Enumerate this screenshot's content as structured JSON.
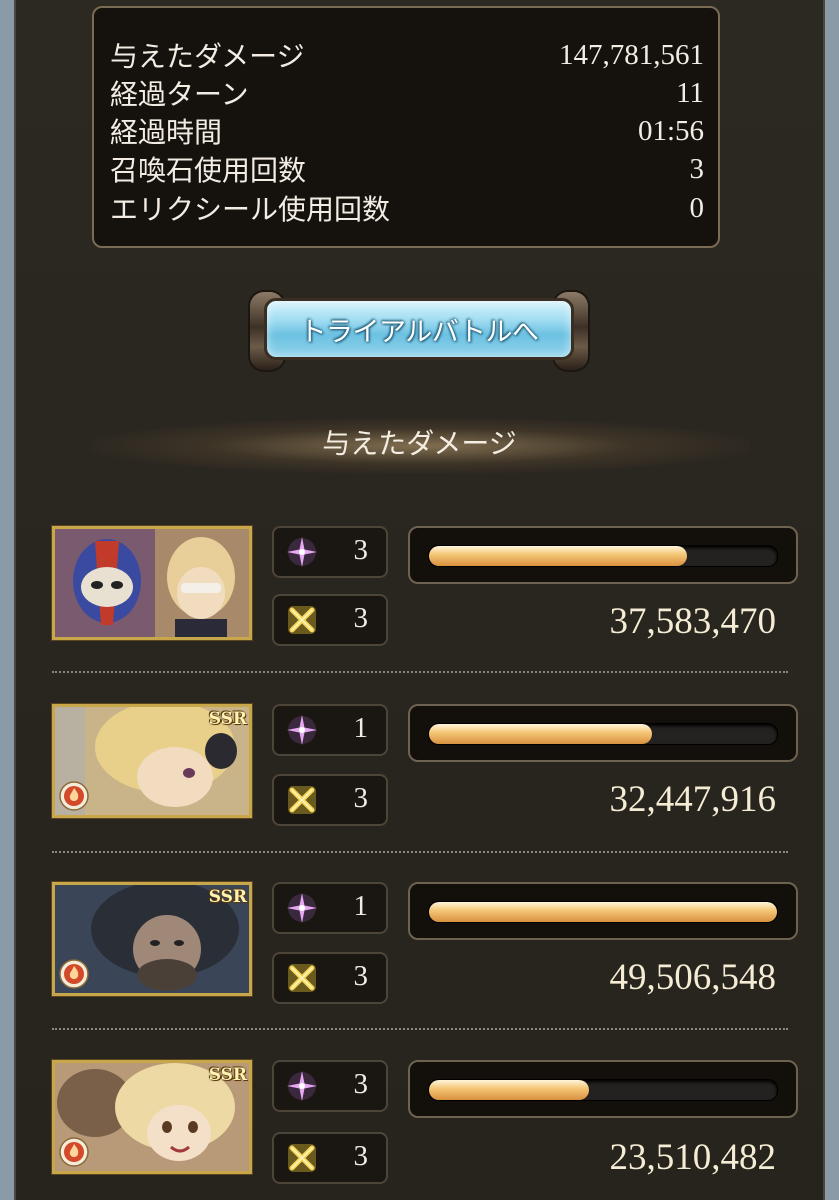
{
  "stats": [
    {
      "label": "与えたダメージ",
      "value": "147,781,561"
    },
    {
      "label": "経過ターン",
      "value": "11"
    },
    {
      "label": "経過時間",
      "value": "01:56"
    },
    {
      "label": "召喚石使用回数",
      "value": "3"
    },
    {
      "label": "エリクシール使用回数",
      "value": "0"
    }
  ],
  "trial_button": {
    "label": "トライアルバトルへ"
  },
  "section": {
    "title": "与えたダメージ"
  },
  "rarity_badge": "SSR",
  "members": [
    {
      "skills_used": "3",
      "ougi_used": "3",
      "damage": "37,583,470",
      "bar_fill": 0.74,
      "ssr": false
    },
    {
      "skills_used": "1",
      "ougi_used": "3",
      "damage": "32,447,916",
      "bar_fill": 0.64,
      "ssr": true
    },
    {
      "skills_used": "1",
      "ougi_used": "3",
      "damage": "49,506,548",
      "bar_fill": 1.0,
      "ssr": true
    },
    {
      "skills_used": "3",
      "ougi_used": "3",
      "damage": "23,510,482",
      "bar_fill": 0.46,
      "ssr": true
    }
  ],
  "icons": {
    "skill": "purple-sparkle-icon",
    "ougi": "crossed-swords-icon",
    "element": "fire-element-icon"
  },
  "colors": {
    "bar_fill": "#f6c97a",
    "ssr_gold": "#c8a64a",
    "skill": "#d48ae6",
    "fire": "#d24a2a"
  }
}
